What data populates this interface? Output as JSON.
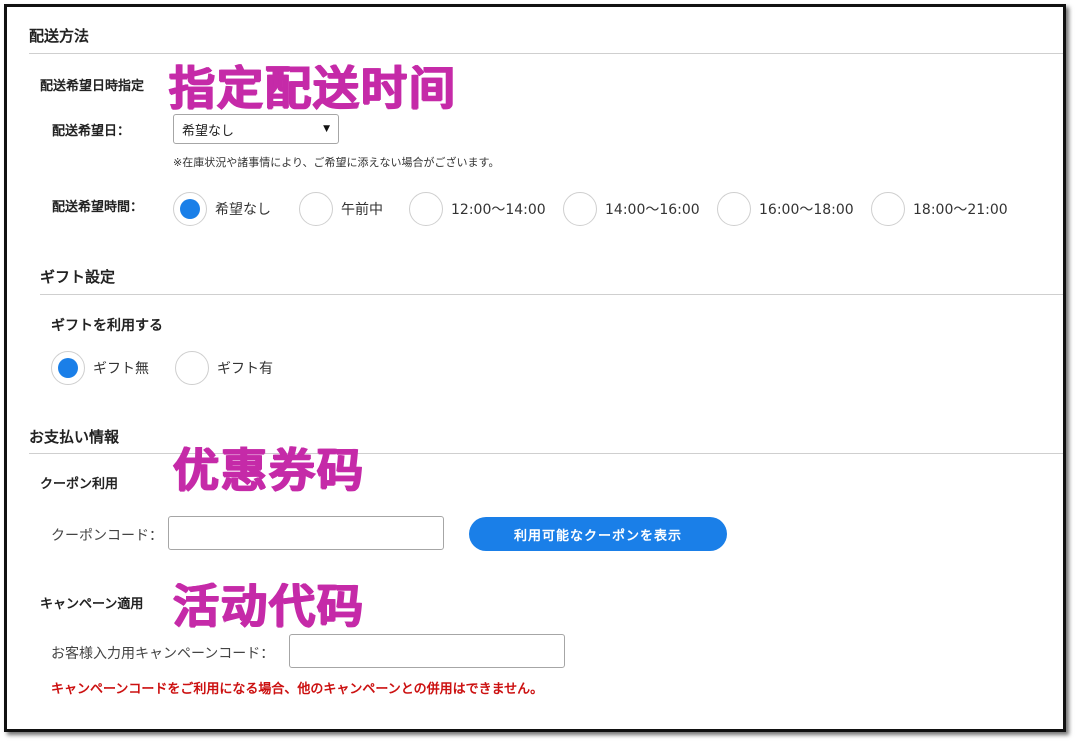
{
  "shipping": {
    "title": "配送方法",
    "datetime_title": "配送希望日時指定",
    "date_label": "配送希望日：",
    "date_value": "希望なし",
    "note": "※在庫状況や諸事情により、ご希望に添えない場合がございます。",
    "time_label": "配送希望時間：",
    "time_options": [
      "希望なし",
      "午前中",
      "12:00〜14:00",
      "14:00〜16:00",
      "16:00〜18:00",
      "18:00〜21:00"
    ],
    "time_selected_index": 0
  },
  "gift": {
    "title": "ギフト設定",
    "use_label": "ギフトを利用する",
    "options": [
      "ギフト無",
      "ギフト有"
    ],
    "selected_index": 0
  },
  "payment": {
    "title": "お支払い情報",
    "coupon_title": "クーポン利用",
    "coupon_code_label": "クーポンコード：",
    "coupon_button": "利用可能なクーポンを表示",
    "campaign_title": "キャンペーン適用",
    "campaign_code_label": "お客様入力用キャンペーンコード：",
    "campaign_warning": "キャンペーンコードをご利用になる場合、他のキャンペーンとの併用はできません。"
  },
  "annotations": {
    "delivery_time": "指定配送时间",
    "coupon": "优惠券码",
    "campaign": "活动代码",
    "color": "#c52aa8"
  },
  "colors": {
    "accent": "#1a7fe8",
    "warning": "#cc1111"
  }
}
